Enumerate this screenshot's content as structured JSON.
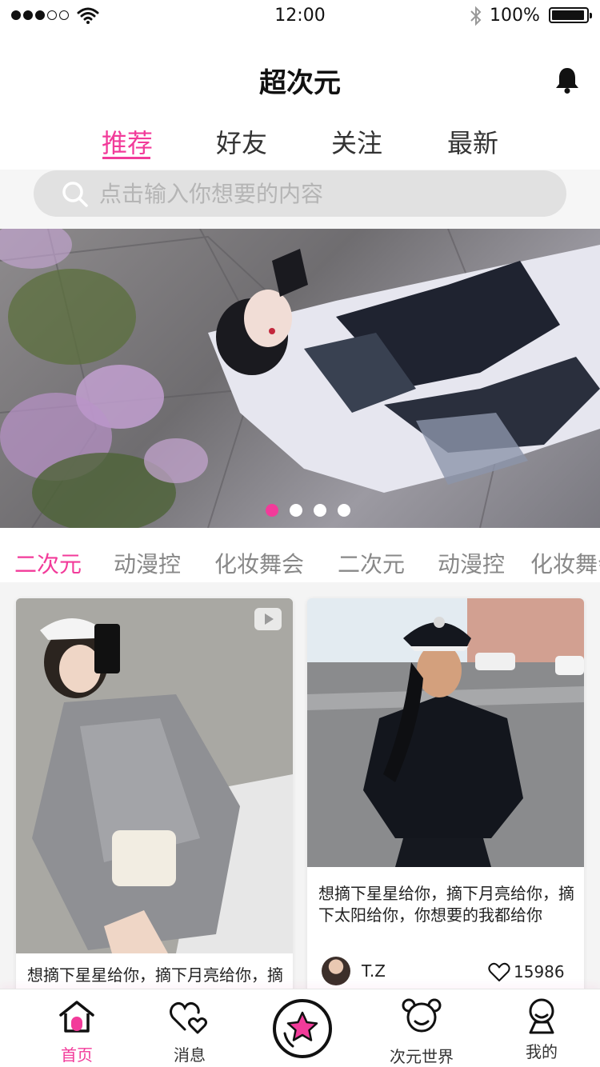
{
  "status_bar": {
    "time": "12:00",
    "battery": "100%"
  },
  "header": {
    "title": "超次元"
  },
  "tabs": [
    {
      "label": "推荐",
      "active": true
    },
    {
      "label": "好友",
      "active": false
    },
    {
      "label": "关注",
      "active": false
    },
    {
      "label": "最新",
      "active": false
    }
  ],
  "search": {
    "placeholder": "点击输入你想要的内容"
  },
  "banner": {
    "dots": 4,
    "active_index": 0
  },
  "categories": [
    {
      "label": "二次元",
      "active": true
    },
    {
      "label": "动漫控",
      "active": false
    },
    {
      "label": "化妆舞会",
      "active": false
    },
    {
      "label": "二次元",
      "active": false
    },
    {
      "label": "动漫控",
      "active": false
    },
    {
      "label": "化妆舞会",
      "active": false
    }
  ],
  "feed": {
    "cards": [
      {
        "text": "想摘下星星给你，摘下月亮给你，摘",
        "has_video": true
      },
      {
        "text": "想摘下星星给你，摘下月亮给你，摘下太阳给你，你想要的我都给你",
        "author": "T.Z",
        "likes": "15986"
      }
    ]
  },
  "tabbar": {
    "items": [
      {
        "label": "首页",
        "icon": "home-icon",
        "active": true
      },
      {
        "label": "消息",
        "icon": "hearts-icon",
        "active": false
      },
      {
        "label": "",
        "icon": "star-icon",
        "active": false
      },
      {
        "label": "次元世界",
        "icon": "bear-icon",
        "active": false
      },
      {
        "label": "我的",
        "icon": "user-icon",
        "active": false
      }
    ]
  },
  "colors": {
    "accent": "#f23b9a",
    "text": "#222222",
    "muted": "#888888"
  }
}
